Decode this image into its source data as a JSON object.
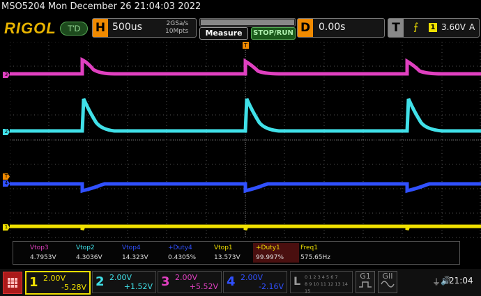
{
  "title_bar": "MSO5204  Mon December 26 21:04:03 2022",
  "logo": "RIGOL",
  "run_state": "T'D",
  "horizontal": {
    "letter": "H",
    "timebase": "500us",
    "sample_rate": "2GSa/s",
    "memory_depth": "10Mpts"
  },
  "buttons": {
    "measure": "Measure",
    "stop_run": "STOP/RUN"
  },
  "delay": {
    "letter": "D",
    "value": "0.00s"
  },
  "trigger": {
    "letter": "T",
    "edge_icon": "rising-edge-icon",
    "source": "1",
    "level": "3.60V",
    "mode": "A",
    "marker": "T"
  },
  "channel_markers": [
    "3",
    "2",
    "T",
    "1"
  ],
  "measurements": [
    {
      "name": "Vtop3",
      "value": "4.7953V",
      "color": "#e040c0"
    },
    {
      "name": "Vtop2",
      "value": "4.3036V",
      "color": "#40e0e8"
    },
    {
      "name": "Vtop4",
      "value": "14.323V",
      "color": "#3050ff"
    },
    {
      "name": "+Duty4",
      "value": "0.4305%",
      "color": "#3050ff"
    },
    {
      "name": "Vtop1",
      "value": "13.573V",
      "color": "#f0e000"
    },
    {
      "name": "+Duty1",
      "value": "99.997%",
      "color": "#f0e000"
    },
    {
      "name": "Freq1",
      "value": "575.65Hz",
      "color": "#f0e000"
    }
  ],
  "channels": [
    {
      "num": "1",
      "scale": "2.00V",
      "offset": "-5.28V",
      "color": "#f0e000"
    },
    {
      "num": "2",
      "scale": "2.00V",
      "offset": "+1.52V",
      "color": "#40e0e8"
    },
    {
      "num": "3",
      "scale": "2.00V",
      "offset": "+5.52V",
      "color": "#e040c0"
    },
    {
      "num": "4",
      "scale": "2.00V",
      "offset": "-2.16V",
      "color": "#3050ff"
    }
  ],
  "logic": {
    "letter": "L",
    "row1": "0 1 2 3 4 5 6 7",
    "row2": "8 9 10 11 12 13 14 15"
  },
  "generators": [
    "G1",
    "GII"
  ],
  "clock": "21:04",
  "colors": {
    "ch1": "#f0e000",
    "ch2": "#40e0e8",
    "ch3": "#e040c0",
    "ch4": "#3050ff",
    "accent": "#f08a00"
  }
}
